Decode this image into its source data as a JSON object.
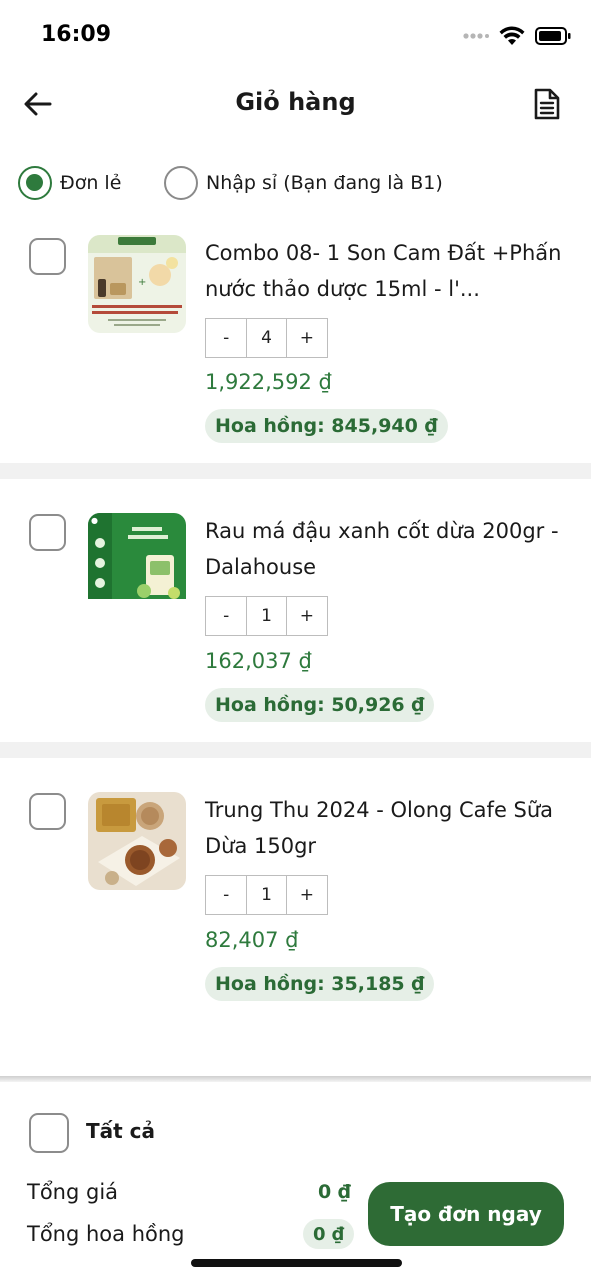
{
  "status_bar": {
    "time": "16:09"
  },
  "header": {
    "title": "Giỏ hàng"
  },
  "mode": {
    "options": [
      {
        "label": "Đơn lẻ",
        "selected": true
      },
      {
        "label": "Nhập sỉ (Bạn đang là B1)",
        "selected": false
      }
    ]
  },
  "items": [
    {
      "name": "Combo 08-  1 Son Cam Đất +Phấn nước thảo dược 15ml - l'...",
      "quantity": "4",
      "price": "1,922,592 ₫",
      "commission": "Hoa hồng: 845,940 ₫",
      "checked": false
    },
    {
      "name": "Rau má đậu xanh cốt dừa 200gr - Dalahouse",
      "quantity": "1",
      "price": "162,037 ₫",
      "commission": "Hoa hồng: 50,926 ₫",
      "checked": false
    },
    {
      "name": "Trung Thu 2024 - Olong Cafe Sữa Dừa 150gr",
      "quantity": "1",
      "price": "82,407 ₫",
      "commission": "Hoa hồng: 35,185 ₫",
      "checked": false
    }
  ],
  "qty_controls": {
    "minus": "-",
    "plus": "+"
  },
  "footer": {
    "select_all_label": "Tất cả",
    "total_price_label": "Tổng giá",
    "total_price_value": "0 ₫",
    "total_commission_label": "Tổng hoa hồng",
    "total_commission_value": "0 ₫",
    "create_order_label": "Tạo đơn ngay"
  },
  "colors": {
    "accent": "#2e7a3d",
    "button": "#2e6b35",
    "commission_bg": "#e6efe7",
    "separator": "#f1f1f1"
  }
}
